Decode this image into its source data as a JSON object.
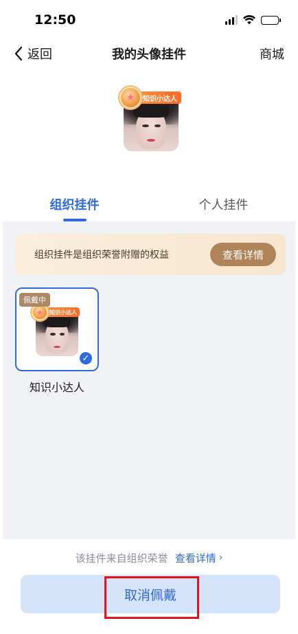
{
  "status_bar": {
    "time": "12:50"
  },
  "nav": {
    "back_label": "返回",
    "title": "我的头像挂件",
    "right_label": "商城"
  },
  "preview": {
    "badge_label": "知识小达人"
  },
  "tabs": [
    {
      "label": "组织挂件",
      "active": true
    },
    {
      "label": "个人挂件",
      "active": false
    }
  ],
  "notice": {
    "text": "组织挂件是组织荣誉附赠的权益",
    "button_label": "查看详情"
  },
  "pendants": [
    {
      "name": "知识小达人",
      "status_tag": "佩戴中",
      "badge_label": "知识小达人",
      "selected": true
    }
  ],
  "footer": {
    "source_text": "该挂件来自组织荣誉",
    "source_link": "查看详情",
    "cancel_label": "取消佩戴"
  },
  "colors": {
    "accent": "#2f6ae0",
    "notice_button": "#b08358",
    "highlight_box": "#e4131a"
  }
}
